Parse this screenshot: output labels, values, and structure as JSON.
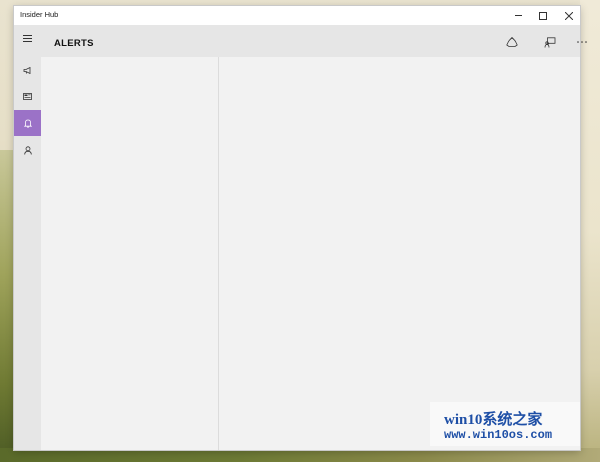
{
  "window": {
    "title": "Insider Hub"
  },
  "header": {
    "title": "ALERTS"
  },
  "icons": {
    "menu": "hamburger-icon",
    "announcements": "megaphone-icon",
    "feed": "feed-icon",
    "alerts": "bell-icon",
    "profile": "person-icon",
    "recycle": "recycle-icon",
    "feedback": "feedback-icon",
    "more": "more-icon"
  },
  "colors": {
    "accent": "#9b72c7",
    "background": "#f2f2f2",
    "chrome": "#e6e6e6"
  },
  "watermark": {
    "line1": "win10系统之家",
    "line2": "www.win10os.com"
  }
}
